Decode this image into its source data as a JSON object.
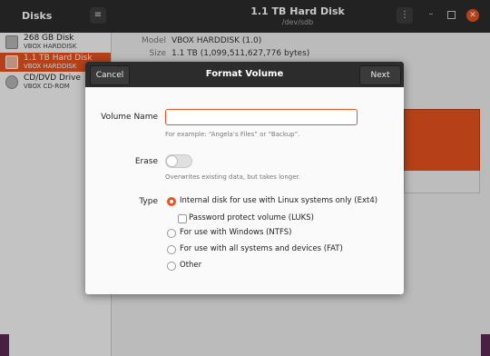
{
  "app": {
    "title": "Disks"
  },
  "header": {
    "disk_title": "1.1 TB Hard Disk",
    "disk_path": "/dev/sdb"
  },
  "sidebar": {
    "items": [
      {
        "name": "268 GB Disk",
        "sub": "VBOX HARDDISK"
      },
      {
        "name": "1.1 TB Hard Disk",
        "sub": "VBOX HARDDISK"
      },
      {
        "name": "CD/DVD Drive",
        "sub": "VBOX CD-ROM"
      }
    ]
  },
  "info": {
    "model_label": "Model",
    "model_value": "VBOX HARDDISK (1.0)",
    "size_label": "Size",
    "size_value": "1.1 TB (1,099,511,627,776 bytes)"
  },
  "dialog": {
    "title": "Format Volume",
    "cancel_label": "Cancel",
    "next_label": "Next",
    "volume_name_label": "Volume Name",
    "volume_name_value": "",
    "volume_name_hint": "For example: “Angela’s Files” or “Backup”.",
    "erase_label": "Erase",
    "erase_hint": "Overwrites existing data, but takes longer.",
    "type_label": "Type",
    "options": [
      "Internal disk for use with Linux systems only (Ext4)",
      "For use with Windows (NTFS)",
      "For use with all systems and devices (FAT)",
      "Other"
    ],
    "password_label": "Password protect volume (LUKS)"
  },
  "colors": {
    "accent": "#e95420",
    "titlebar": "#2c2c2c"
  },
  "icons": {
    "menu": "hamburger-icon",
    "more": "vertical-dots-icon",
    "close": "close-icon",
    "minimize": "minimize-icon",
    "maximize": "maximize-icon",
    "disk": "drive-icon",
    "cdrom": "optical-drive-icon"
  }
}
